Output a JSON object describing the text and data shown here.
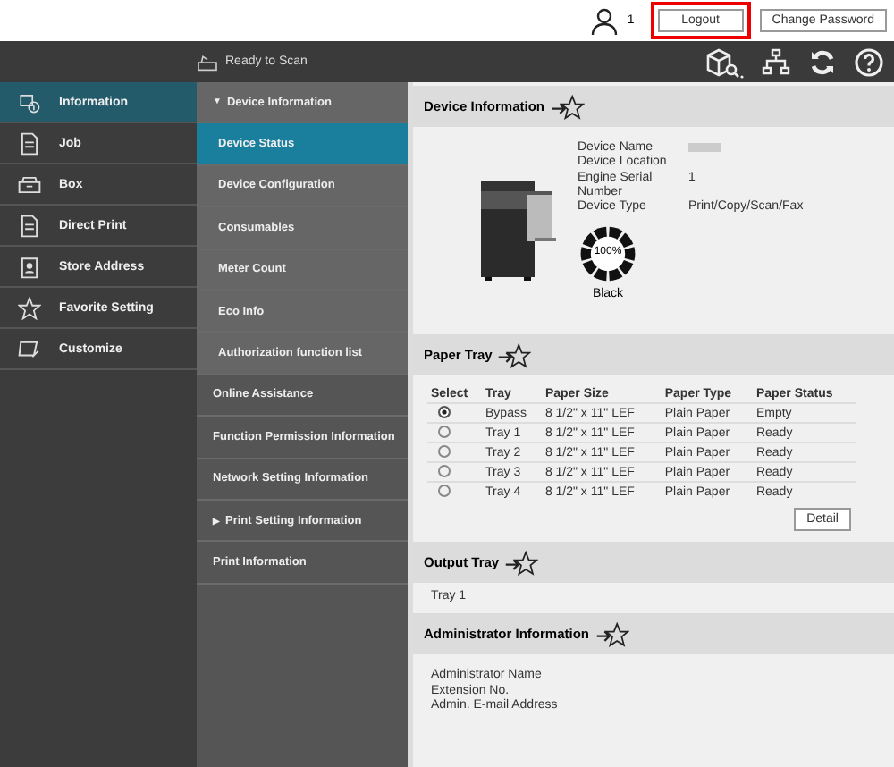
{
  "header": {
    "user_count": "1",
    "logout": "Logout",
    "change_password": "Change Password",
    "logout_highlighted": true
  },
  "status_bar": {
    "status": "Ready to Scan"
  },
  "sidebar": {
    "items": [
      {
        "label": "Information",
        "selected": true
      },
      {
        "label": "Job",
        "selected": false
      },
      {
        "label": "Box",
        "selected": false
      },
      {
        "label": "Direct Print",
        "selected": false
      },
      {
        "label": "Store Address",
        "selected": false
      },
      {
        "label": "Favorite Setting",
        "selected": false
      },
      {
        "label": "Customize",
        "selected": false
      }
    ]
  },
  "submenu": {
    "items": [
      {
        "label": "Device Information",
        "marker": "▼",
        "expanded": true,
        "children": [
          {
            "label": "Device Status",
            "selected": true
          },
          {
            "label": "Device Configuration",
            "selected": false
          },
          {
            "label": "Consumables",
            "selected": false
          },
          {
            "label": "Meter Count",
            "selected": false
          },
          {
            "label": "Eco Info",
            "selected": false
          },
          {
            "label": "Authorization function list",
            "selected": false
          }
        ]
      },
      {
        "label": "Online Assistance"
      },
      {
        "label": "Function Permission Information"
      },
      {
        "label": "Network Setting Information"
      },
      {
        "label": "Print Setting Information",
        "marker": "▶",
        "expanded": false
      },
      {
        "label": "Print Information"
      }
    ]
  },
  "device_information": {
    "title": "Device Information",
    "fields": [
      {
        "label": "Device Name"
      },
      {
        "label": "Device Location"
      },
      {
        "label": "Engine Serial Number",
        "value": "1"
      },
      {
        "label": "Device Type",
        "value": "Print/Copy/Scan/Fax"
      }
    ],
    "toner": {
      "reading": "100%",
      "label": "Black",
      "level": 1
    }
  },
  "paper_tray": {
    "title": "Paper Tray",
    "columns": [
      "Select",
      "Tray",
      "Paper Size",
      "Paper Type",
      "Paper Status"
    ],
    "rows": [
      {
        "selected": true,
        "tray": "Bypass",
        "size": "8 1/2\" x 11\" LEF",
        "type": "Plain Paper",
        "status": "Empty"
      },
      {
        "selected": false,
        "tray": "Tray 1",
        "size": "8 1/2\" x 11\" LEF",
        "type": "Plain Paper",
        "status": "Ready"
      },
      {
        "selected": false,
        "tray": "Tray 2",
        "size": "8 1/2\" x 11\" LEF",
        "type": "Plain Paper",
        "status": "Ready"
      },
      {
        "selected": false,
        "tray": "Tray 3",
        "size": "8 1/2\" x 11\" LEF",
        "type": "Plain Paper",
        "status": "Ready"
      },
      {
        "selected": false,
        "tray": "Tray 4",
        "size": "8 1/2\" x 11\" LEF",
        "type": "Plain Paper",
        "status": "Ready"
      }
    ],
    "detail_button": "Detail"
  },
  "output_tray": {
    "title": "Output Tray",
    "value": "Tray 1"
  },
  "administrator_information": {
    "title": "Administrator Information",
    "lines": [
      "Administrator Name",
      "Extension No.",
      "Admin. E-mail Address"
    ]
  }
}
